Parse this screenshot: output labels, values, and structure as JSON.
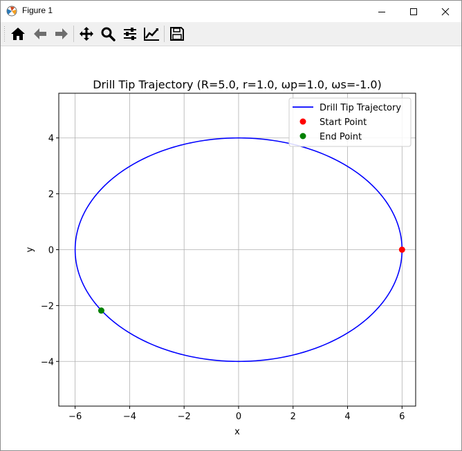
{
  "window": {
    "title": "Figure 1",
    "icon": "matplotlib-icon",
    "controls": [
      "minimize-icon",
      "maximize-icon",
      "close-icon"
    ]
  },
  "toolbar": {
    "buttons": [
      {
        "name": "home-button",
        "icon": "home-icon"
      },
      {
        "name": "back-button",
        "icon": "arrow-left-icon"
      },
      {
        "name": "forward-button",
        "icon": "arrow-right-icon"
      },
      {
        "name": "pan-button",
        "icon": "move-icon"
      },
      {
        "name": "zoom-button",
        "icon": "magnifier-icon"
      },
      {
        "name": "subplots-button",
        "icon": "sliders-icon"
      },
      {
        "name": "edit-axis-button",
        "icon": "line-chart-icon"
      },
      {
        "name": "save-button",
        "icon": "floppy-disk-icon"
      }
    ]
  },
  "chart_data": {
    "type": "line",
    "title": "Drill Tip Trajectory (R=5.0, r=1.0, ωp=1.0, ωs=-1.0)",
    "xlabel": "x",
    "ylabel": "y",
    "xlim": [
      -6.6,
      6.5
    ],
    "ylim": [
      -5.6,
      5.6
    ],
    "xticks": [
      -6,
      -4,
      -2,
      0,
      2,
      4,
      6
    ],
    "yticks": [
      -4,
      -2,
      0,
      2,
      4
    ],
    "xtick_labels": [
      "−6",
      "−4",
      "−2",
      "0",
      "2",
      "4",
      "6"
    ],
    "ytick_labels": [
      "−4",
      "−2",
      "0",
      "2",
      "4"
    ],
    "grid": true,
    "legend_position": "top-right",
    "series": [
      {
        "name": "Drill Tip Trajectory",
        "kind": "line",
        "color": "#0000ff",
        "curve": "ellipse",
        "center": [
          0,
          0
        ],
        "semi_axis_x": 6.0,
        "semi_axis_y": 4.0
      },
      {
        "name": "Start Point",
        "kind": "scatter",
        "color": "#ff0000",
        "points": [
          [
            6.0,
            0.0
          ]
        ]
      },
      {
        "name": "End Point",
        "kind": "scatter",
        "color": "#008000",
        "points": [
          [
            -5.04,
            -2.18
          ]
        ]
      }
    ]
  }
}
